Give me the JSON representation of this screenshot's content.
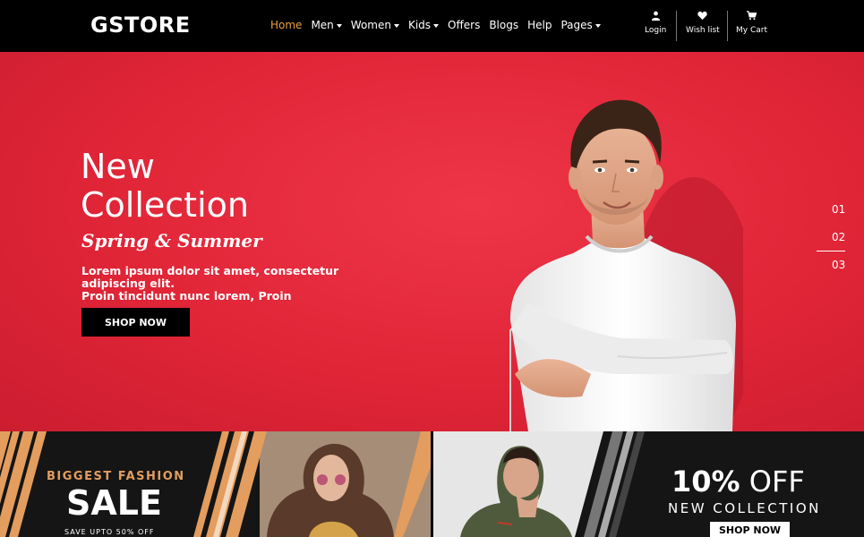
{
  "brand": "GSTORE",
  "nav": {
    "items": [
      {
        "label": "Home",
        "active": true,
        "dropdown": false
      },
      {
        "label": "Men",
        "active": false,
        "dropdown": true
      },
      {
        "label": "Women",
        "active": false,
        "dropdown": true
      },
      {
        "label": "Kids",
        "active": false,
        "dropdown": true
      },
      {
        "label": "Offers",
        "active": false,
        "dropdown": false
      },
      {
        "label": "Blogs",
        "active": false,
        "dropdown": false
      },
      {
        "label": "Help",
        "active": false,
        "dropdown": false
      },
      {
        "label": "Pages",
        "active": false,
        "dropdown": true
      }
    ],
    "utilities": {
      "login": {
        "label": "Login",
        "icon": "user-icon"
      },
      "wishlist": {
        "label": "Wish list",
        "icon": "heart-icon"
      },
      "cart": {
        "label": "My Cart",
        "icon": "cart-icon"
      }
    }
  },
  "hero": {
    "title_line1": "New",
    "title_line2": "Collection",
    "subtitle": "Spring & Summer",
    "desc_line1": "Lorem ipsum dolor sit amet, consectetur adipiscing elit.",
    "desc_line2": "Proin tincidunt nunc lorem, Proin",
    "button": "SHOP NOW",
    "slides": [
      "01",
      "02",
      "03"
    ],
    "active_slide": "02",
    "background_color": "#e02537"
  },
  "banners": {
    "left": {
      "line1": "BIGGEST FASHION",
      "line2": "SALE",
      "line3": "SAVE UPTO 50% OFF"
    },
    "right": {
      "line1_bold": "10%",
      "line1_rest": " OFF",
      "line2": "NEW COLLECTION",
      "button": "SHOP NOW"
    }
  },
  "colors": {
    "accent": "#e9a23b",
    "banner_orange": "#e39d5e",
    "navbar": "#000000"
  }
}
